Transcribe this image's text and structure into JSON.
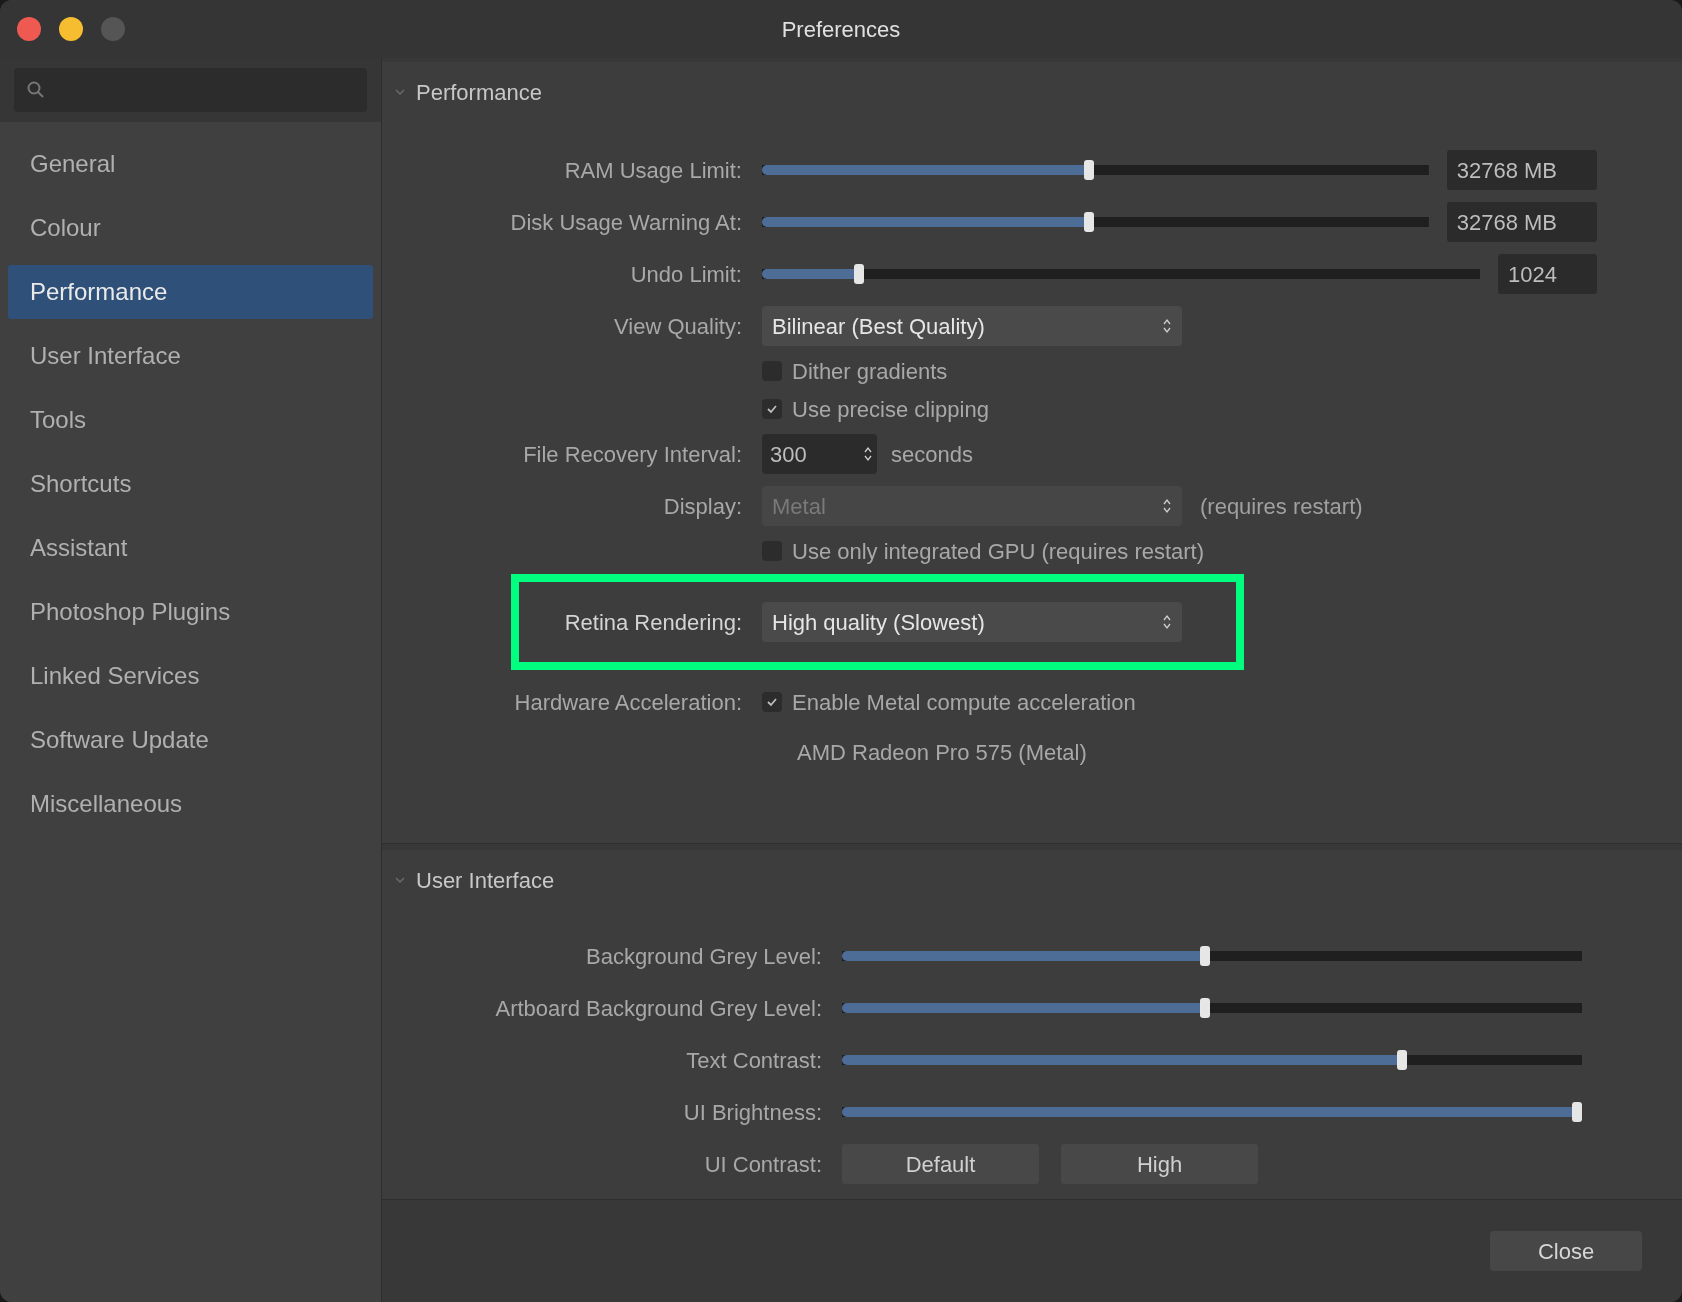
{
  "window": {
    "title": "Preferences"
  },
  "sidebar": {
    "items": [
      {
        "label": "General",
        "selected": false
      },
      {
        "label": "Colour",
        "selected": false
      },
      {
        "label": "Performance",
        "selected": true
      },
      {
        "label": "User Interface",
        "selected": false
      },
      {
        "label": "Tools",
        "selected": false
      },
      {
        "label": "Shortcuts",
        "selected": false
      },
      {
        "label": "Assistant",
        "selected": false
      },
      {
        "label": "Photoshop Plugins",
        "selected": false
      },
      {
        "label": "Linked Services",
        "selected": false
      },
      {
        "label": "Software Update",
        "selected": false
      },
      {
        "label": "Miscellaneous",
        "selected": false
      }
    ]
  },
  "sections": [
    {
      "title": "Performance",
      "expanded": true,
      "rows": [
        {
          "kind": "slider",
          "label": "RAM Usage Limit:",
          "level": 0.49,
          "value": "32768 MB"
        },
        {
          "kind": "slider",
          "label": "Disk Usage Warning At:",
          "level": 0.49,
          "value": "32768 MB"
        },
        {
          "kind": "slider",
          "label": "Undo Limit:",
          "level": 0.13,
          "value": "1024"
        },
        {
          "kind": "dropdown",
          "label": "View Quality:",
          "value": "Bilinear (Best Quality)",
          "disabled": false,
          "highlighted": false
        },
        {
          "kind": "checkbox",
          "text": "Dither gradients",
          "checked": false
        },
        {
          "kind": "checkbox",
          "text": "Use precise clipping",
          "checked": true
        },
        {
          "kind": "stepper",
          "label": "File Recovery Interval:",
          "value": "300",
          "suffix": "seconds"
        },
        {
          "kind": "dropdown",
          "label": "Display:",
          "value": "Metal",
          "disabled": true,
          "highlighted": false,
          "note": "(requires restart)"
        },
        {
          "kind": "checkbox",
          "text": "Use only integrated GPU (requires restart)",
          "checked": false
        },
        {
          "kind": "dropdown",
          "label": "Retina Rendering:",
          "value": "High quality (Slowest)",
          "disabled": false,
          "highlighted": true
        },
        {
          "kind": "checkbox",
          "label": "Hardware Acceleration:",
          "text": "Enable Metal compute acceleration",
          "checked": true
        },
        {
          "kind": "info",
          "text": "AMD Radeon Pro 575 (Metal)"
        }
      ]
    },
    {
      "title": "User Interface",
      "expanded": true,
      "rows": [
        {
          "kind": "slider",
          "label": "Background Grey Level:",
          "level": 0.49
        },
        {
          "kind": "slider",
          "label": "Artboard Background Grey Level:",
          "level": 0.49
        },
        {
          "kind": "slider",
          "label": "Text Contrast:",
          "level": 0.76
        },
        {
          "kind": "slider",
          "label": "UI Brightness:",
          "level": 1
        },
        {
          "kind": "segmented",
          "label": "UI Contrast:",
          "options": [
            "Default",
            "High"
          ]
        }
      ]
    }
  ],
  "footer": {
    "button": "Close"
  }
}
